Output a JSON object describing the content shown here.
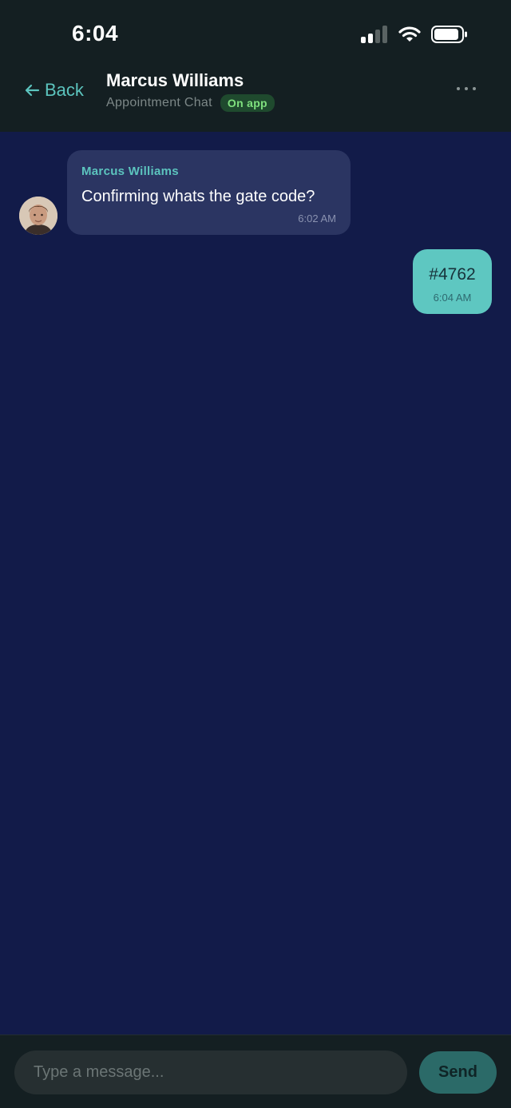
{
  "status_bar": {
    "time": "6:04"
  },
  "header": {
    "back_label": "Back",
    "contact_name": "Marcus Williams",
    "subtitle": "Appointment Chat",
    "badge": "On app"
  },
  "messages": [
    {
      "direction": "incoming",
      "sender": "Marcus Williams",
      "text": "Confirming whats the gate code?",
      "time": "6:02 AM"
    },
    {
      "direction": "outgoing",
      "text": "#4762",
      "time": "6:04 AM"
    }
  ],
  "composer": {
    "placeholder": "Type a message...",
    "value": "",
    "send_label": "Send"
  },
  "colors": {
    "accent": "#5cc4be",
    "background": "#121b49",
    "header_bg": "#141f22",
    "incoming_bubble": "#2b3562",
    "outgoing_bubble": "#5ec7c1",
    "badge_bg": "#1f4a2e",
    "badge_text": "#7fe07e"
  },
  "icons": [
    "back-arrow-icon",
    "cellular-signal-icon",
    "wifi-icon",
    "battery-icon",
    "more-options-icon"
  ]
}
